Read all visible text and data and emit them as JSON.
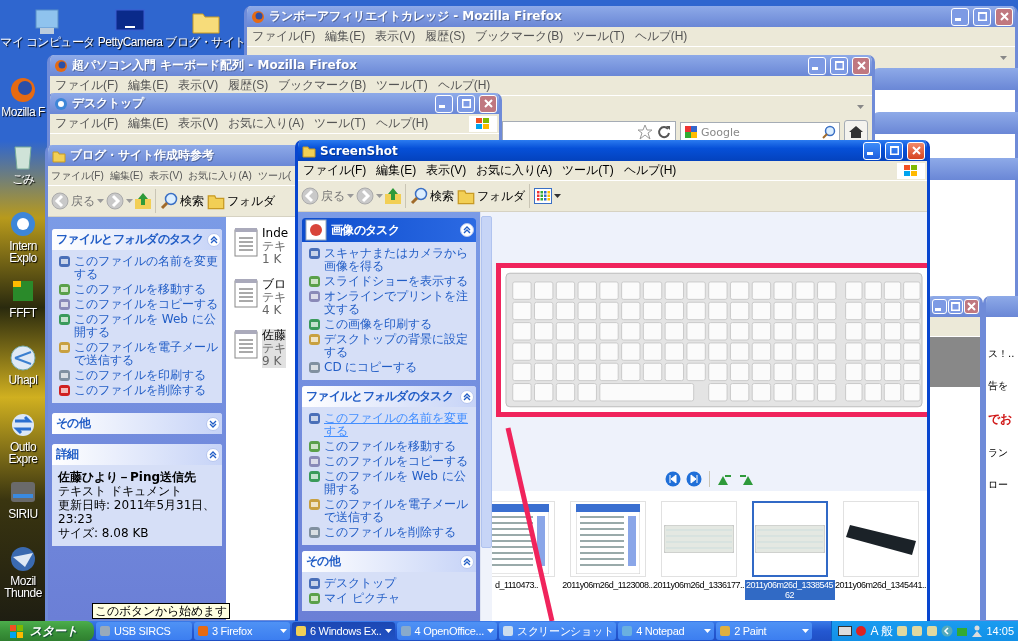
{
  "desktop_icons_top": [
    {
      "label": "マイ コンピュータ"
    },
    {
      "label": "PettyCamera"
    },
    {
      "label": "ブログ・サイト"
    }
  ],
  "desktop_icons_left": [
    {
      "label": "Mozilla F"
    },
    {
      "label": "ごみ"
    },
    {
      "label": "Intern Explo"
    },
    {
      "label": "FFFT"
    },
    {
      "label": "Uhapl"
    },
    {
      "label": "Outlo Expre"
    },
    {
      "label": "SIRIU"
    },
    {
      "label": "Mozil Thunde"
    }
  ],
  "firefox_window_back": {
    "title": "ランボーアフィリエイトカレッジ - Mozilla Firefox",
    "active": false,
    "menu": [
      "ファイル(F)",
      "編集(E)",
      "表示(V)",
      "履歴(S)",
      "ブックマーク(B)",
      "ツール(T)",
      "ヘルプ(H)"
    ]
  },
  "firefox_window_front": {
    "title": "超パソコン入門 キーボード配列 - Mozilla Firefox",
    "active": false,
    "menu": [
      "ファイル(F)",
      "編集(E)",
      "表示(V)",
      "履歴(S)",
      "ブックマーク(B)",
      "ツール(T)",
      "ヘルプ(H)"
    ],
    "search": {
      "placeholder": "Google"
    }
  },
  "desktop_window": {
    "title": "デスクトップ",
    "active": false,
    "menu": [
      "ファイル(F)",
      "編集(E)",
      "表示(V)",
      "お気に入り(A)",
      "ツール(T)",
      "ヘルプ(H)"
    ]
  },
  "blog_window": {
    "title": "ブログ・サイト作成時参考",
    "active": false,
    "menu": [
      "ファイル(F)",
      "編集(E)",
      "表示(V)",
      "お気に入り(A)",
      "ツール("
    ],
    "toolbar": {
      "back": "戻る",
      "search": "検索",
      "folders": "フォルダ"
    },
    "panels": [
      {
        "kind": "tasks",
        "title": "ファイルとフォルダのタスク",
        "expanded": true,
        "items": [
          {
            "text": "このファイルの名前を変更する",
            "hover": false
          },
          {
            "text": "このファイルを移動する",
            "hover": false
          },
          {
            "text": "このファイルをコピーする",
            "hover": false
          },
          {
            "text": "このファイルを Web に公開する",
            "hover": false
          },
          {
            "text": "このファイルを電子メールで送信する",
            "hover": false
          },
          {
            "text": "このファイルを印刷する",
            "hover": false
          },
          {
            "text": "このファイルを削除する",
            "hover": false
          }
        ]
      },
      {
        "kind": "tasks",
        "title": "その他",
        "expanded": false
      },
      {
        "kind": "details",
        "title": "詳細",
        "expanded": true,
        "name": "佐藤ひより－Ping送信先",
        "lines": [
          "テキスト ドキュメント",
          "更新日時: 2011年5月31日、23:23",
          "サイズ: 8.08 KB"
        ]
      }
    ],
    "files": [
      {
        "lines": [
          "Inde",
          "テキ",
          "1 K"
        ],
        "selected": false
      },
      {
        "lines": [
          "ブロ",
          "テキ",
          "4 K"
        ],
        "selected": false
      },
      {
        "lines": [
          "佐藤",
          "テキ",
          "9 K"
        ],
        "selected": true
      }
    ]
  },
  "right_window": {
    "active": false,
    "texts": [
      {
        "text": "ス！..",
        "kind": "plain"
      },
      {
        "text": "告を",
        "kind": "plain"
      },
      {
        "text": "でお",
        "kind": "alert"
      },
      {
        "text": "ラン",
        "kind": "plain"
      },
      {
        "text": "ロー",
        "kind": "plain"
      }
    ]
  },
  "screenshot_window": {
    "title": "ScreenShot",
    "active": true,
    "menu": [
      "ファイル(F)",
      "編集(E)",
      "表示(V)",
      "お気に入り(A)",
      "ツール(T)",
      "ヘルプ(H)"
    ],
    "toolbar": {
      "back": "戻る",
      "search": "検索",
      "folders": "フォルダ"
    },
    "panels": [
      {
        "kind": "special",
        "title": "画像のタスク",
        "expanded": true,
        "items": [
          {
            "text": "スキャナまたはカメラから画像を得る",
            "hover": false
          },
          {
            "text": "スライドショーを表示する",
            "hover": false
          },
          {
            "text": "オンラインでプリントを注文する",
            "hover": false
          },
          {
            "text": "この画像を印刷する",
            "hover": false
          },
          {
            "text": "デスクトップの背景に設定する",
            "hover": false
          },
          {
            "text": "CD にコピーする",
            "hover": false
          }
        ]
      },
      {
        "kind": "tasks",
        "title": "ファイルとフォルダのタスク",
        "expanded": true,
        "items": [
          {
            "text": "このファイルの名前を変更する",
            "hover": true
          },
          {
            "text": "このファイルを移動する",
            "hover": false
          },
          {
            "text": "このファイルをコピーする",
            "hover": false
          },
          {
            "text": "このファイルを Web に公開する",
            "hover": false
          },
          {
            "text": "このファイルを電子メールで送信する",
            "hover": false
          },
          {
            "text": "このファイルを削除する",
            "hover": false
          }
        ]
      },
      {
        "kind": "tasks",
        "title": "その他",
        "expanded": true,
        "items": [
          {
            "text": "デスクトップ",
            "hover": false
          },
          {
            "text": "マイ ピクチャ",
            "hover": false
          }
        ]
      }
    ],
    "thumbnails": [
      {
        "label": "d_1110473..",
        "kind": "page",
        "selected": false
      },
      {
        "label": "2011y06m26d_1123008..",
        "kind": "page",
        "selected": false
      },
      {
        "label": "2011y06m26d_1336177..",
        "kind": "keyboard",
        "selected": false
      },
      {
        "label": "2011y06m26d_133854562",
        "kind": "keyboard",
        "selected": true
      },
      {
        "label": "2011y06m26d_1345441..",
        "kind": "blackkeyboard",
        "selected": false
      }
    ]
  },
  "tooltip": "このボタンから始めます",
  "taskbar": {
    "start": "スタート",
    "tasks": [
      {
        "label": "USB SIRCS",
        "selected": false,
        "grouped": false
      },
      {
        "label": "3 Firefox",
        "selected": false,
        "grouped": true
      },
      {
        "label": "6 Windows Ex..",
        "selected": true,
        "grouped": true
      },
      {
        "label": "4 OpenOffice...",
        "selected": false,
        "grouped": true
      },
      {
        "label": "スクリーンショット",
        "selected": false,
        "grouped": false
      },
      {
        "label": "4 Notepad",
        "selected": false,
        "grouped": true
      },
      {
        "label": "2 Paint",
        "selected": false,
        "grouped": true
      }
    ],
    "ime": [
      "A",
      "般"
    ],
    "clock": "14:05"
  }
}
